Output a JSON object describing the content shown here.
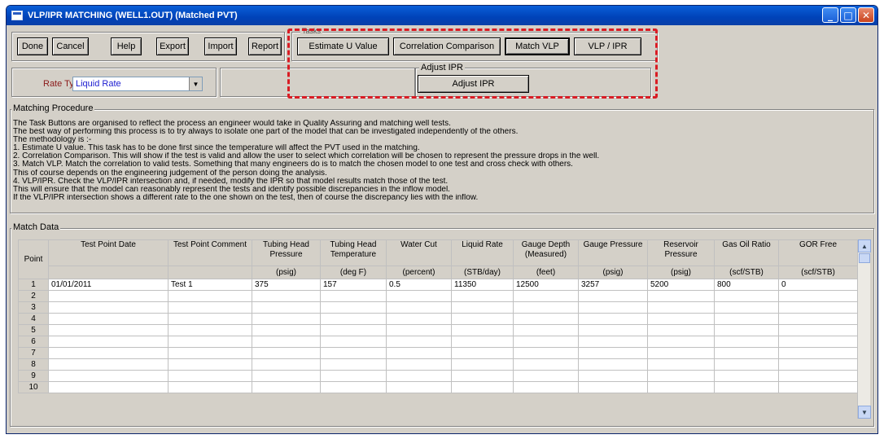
{
  "window": {
    "title": "VLP/IPR MATCHING (WELL1.OUT) (Matched PVT)",
    "controls": [
      "_",
      "□",
      "✕"
    ]
  },
  "toolbar": {
    "done": "Done",
    "cancel": "Cancel",
    "help": "Help",
    "export": "Export",
    "import": "Import",
    "report": "Report"
  },
  "tasks": {
    "label": "Tasks",
    "estimate_u": "Estimate U Value",
    "correlation_comparison": "Correlation Comparison",
    "match_vlp": "Match VLP",
    "vlp_ipr": "VLP / IPR"
  },
  "adjust_ipr": {
    "label": "Adjust IPR",
    "button": "Adjust IPR"
  },
  "rate_type": {
    "label": "Rate Type",
    "value": "Liquid Rate"
  },
  "matching_procedure": {
    "label": "Matching Procedure",
    "lines": [
      "The Task Buttons are organised to reflect the process an engineer would take in Quality Assuring and matching well tests.",
      "The best way of performing this process is to try always to isolate one part of the model that can be investigated independently of the others.",
      " The methodology is :-",
      "1. Estimate U value. This task has to be done first since the temperature will affect the PVT used in the matching.",
      "2. Correlation Comparison. This will show if the test is valid and allow the user to select which correlation will be chosen to represent the pressure drops in the well.",
      "3. Match VLP. Match the correlation to valid tests. Something that many engineers do is to match the chosen model to one test and cross check with others.",
      "   This of course depends on the engineering judgement of the person doing the analysis.",
      "4. VLP/IPR. Check the VLP/IPR intersection and, if needed, modify the IPR so that model results match those of the test.",
      "   This will ensure that the model can reasonably represent the tests and identify possible discrepancies in the inflow model.",
      "   If the VLP/IPR intersection shows a different rate to the one shown on the test, then of course the discrepancy lies with the inflow."
    ]
  },
  "match_data": {
    "label": "Match Data",
    "point_header": "Point",
    "columns": [
      {
        "name": "Test Point Date",
        "unit": ""
      },
      {
        "name": "Test Point Comment",
        "unit": ""
      },
      {
        "name": "Tubing Head Pressure",
        "unit": "(psig)"
      },
      {
        "name": "Tubing Head Temperature",
        "unit": "(deg F)"
      },
      {
        "name": "Water Cut",
        "unit": "(percent)"
      },
      {
        "name": "Liquid Rate",
        "unit": "(STB/day)"
      },
      {
        "name": "Gauge Depth (Measured)",
        "unit": "(feet)"
      },
      {
        "name": "Gauge Pressure",
        "unit": "(psig)"
      },
      {
        "name": "Reservoir Pressure",
        "unit": "(psig)"
      },
      {
        "name": "Gas Oil Ratio",
        "unit": "(scf/STB)"
      },
      {
        "name": "GOR Free",
        "unit": "(scf/STB)"
      }
    ],
    "rows": [
      [
        "1",
        "01/01/2011",
        "Test 1",
        "375",
        "157",
        "0.5",
        "11350",
        "12500",
        "3257",
        "5200",
        "800",
        "0"
      ],
      [
        "2",
        "",
        "",
        "",
        "",
        "",
        "",
        "",
        "",
        "",
        "",
        ""
      ],
      [
        "3",
        "",
        "",
        "",
        "",
        "",
        "",
        "",
        "",
        "",
        "",
        ""
      ],
      [
        "4",
        "",
        "",
        "",
        "",
        "",
        "",
        "",
        "",
        "",
        "",
        ""
      ],
      [
        "5",
        "",
        "",
        "",
        "",
        "",
        "",
        "",
        "",
        "",
        "",
        ""
      ],
      [
        "6",
        "",
        "",
        "",
        "",
        "",
        "",
        "",
        "",
        "",
        "",
        ""
      ],
      [
        "7",
        "",
        "",
        "",
        "",
        "",
        "",
        "",
        "",
        "",
        "",
        ""
      ],
      [
        "8",
        "",
        "",
        "",
        "",
        "",
        "",
        "",
        "",
        "",
        "",
        ""
      ],
      [
        "9",
        "",
        "",
        "",
        "",
        "",
        "",
        "",
        "",
        "",
        "",
        ""
      ],
      [
        "10",
        "",
        "",
        "",
        "",
        "",
        "",
        "",
        "",
        "",
        "",
        ""
      ]
    ]
  },
  "colors": {
    "highlight": "#d91c24",
    "titlebar": "#0a5fd8",
    "dialog_bg": "#d4d0c8"
  }
}
